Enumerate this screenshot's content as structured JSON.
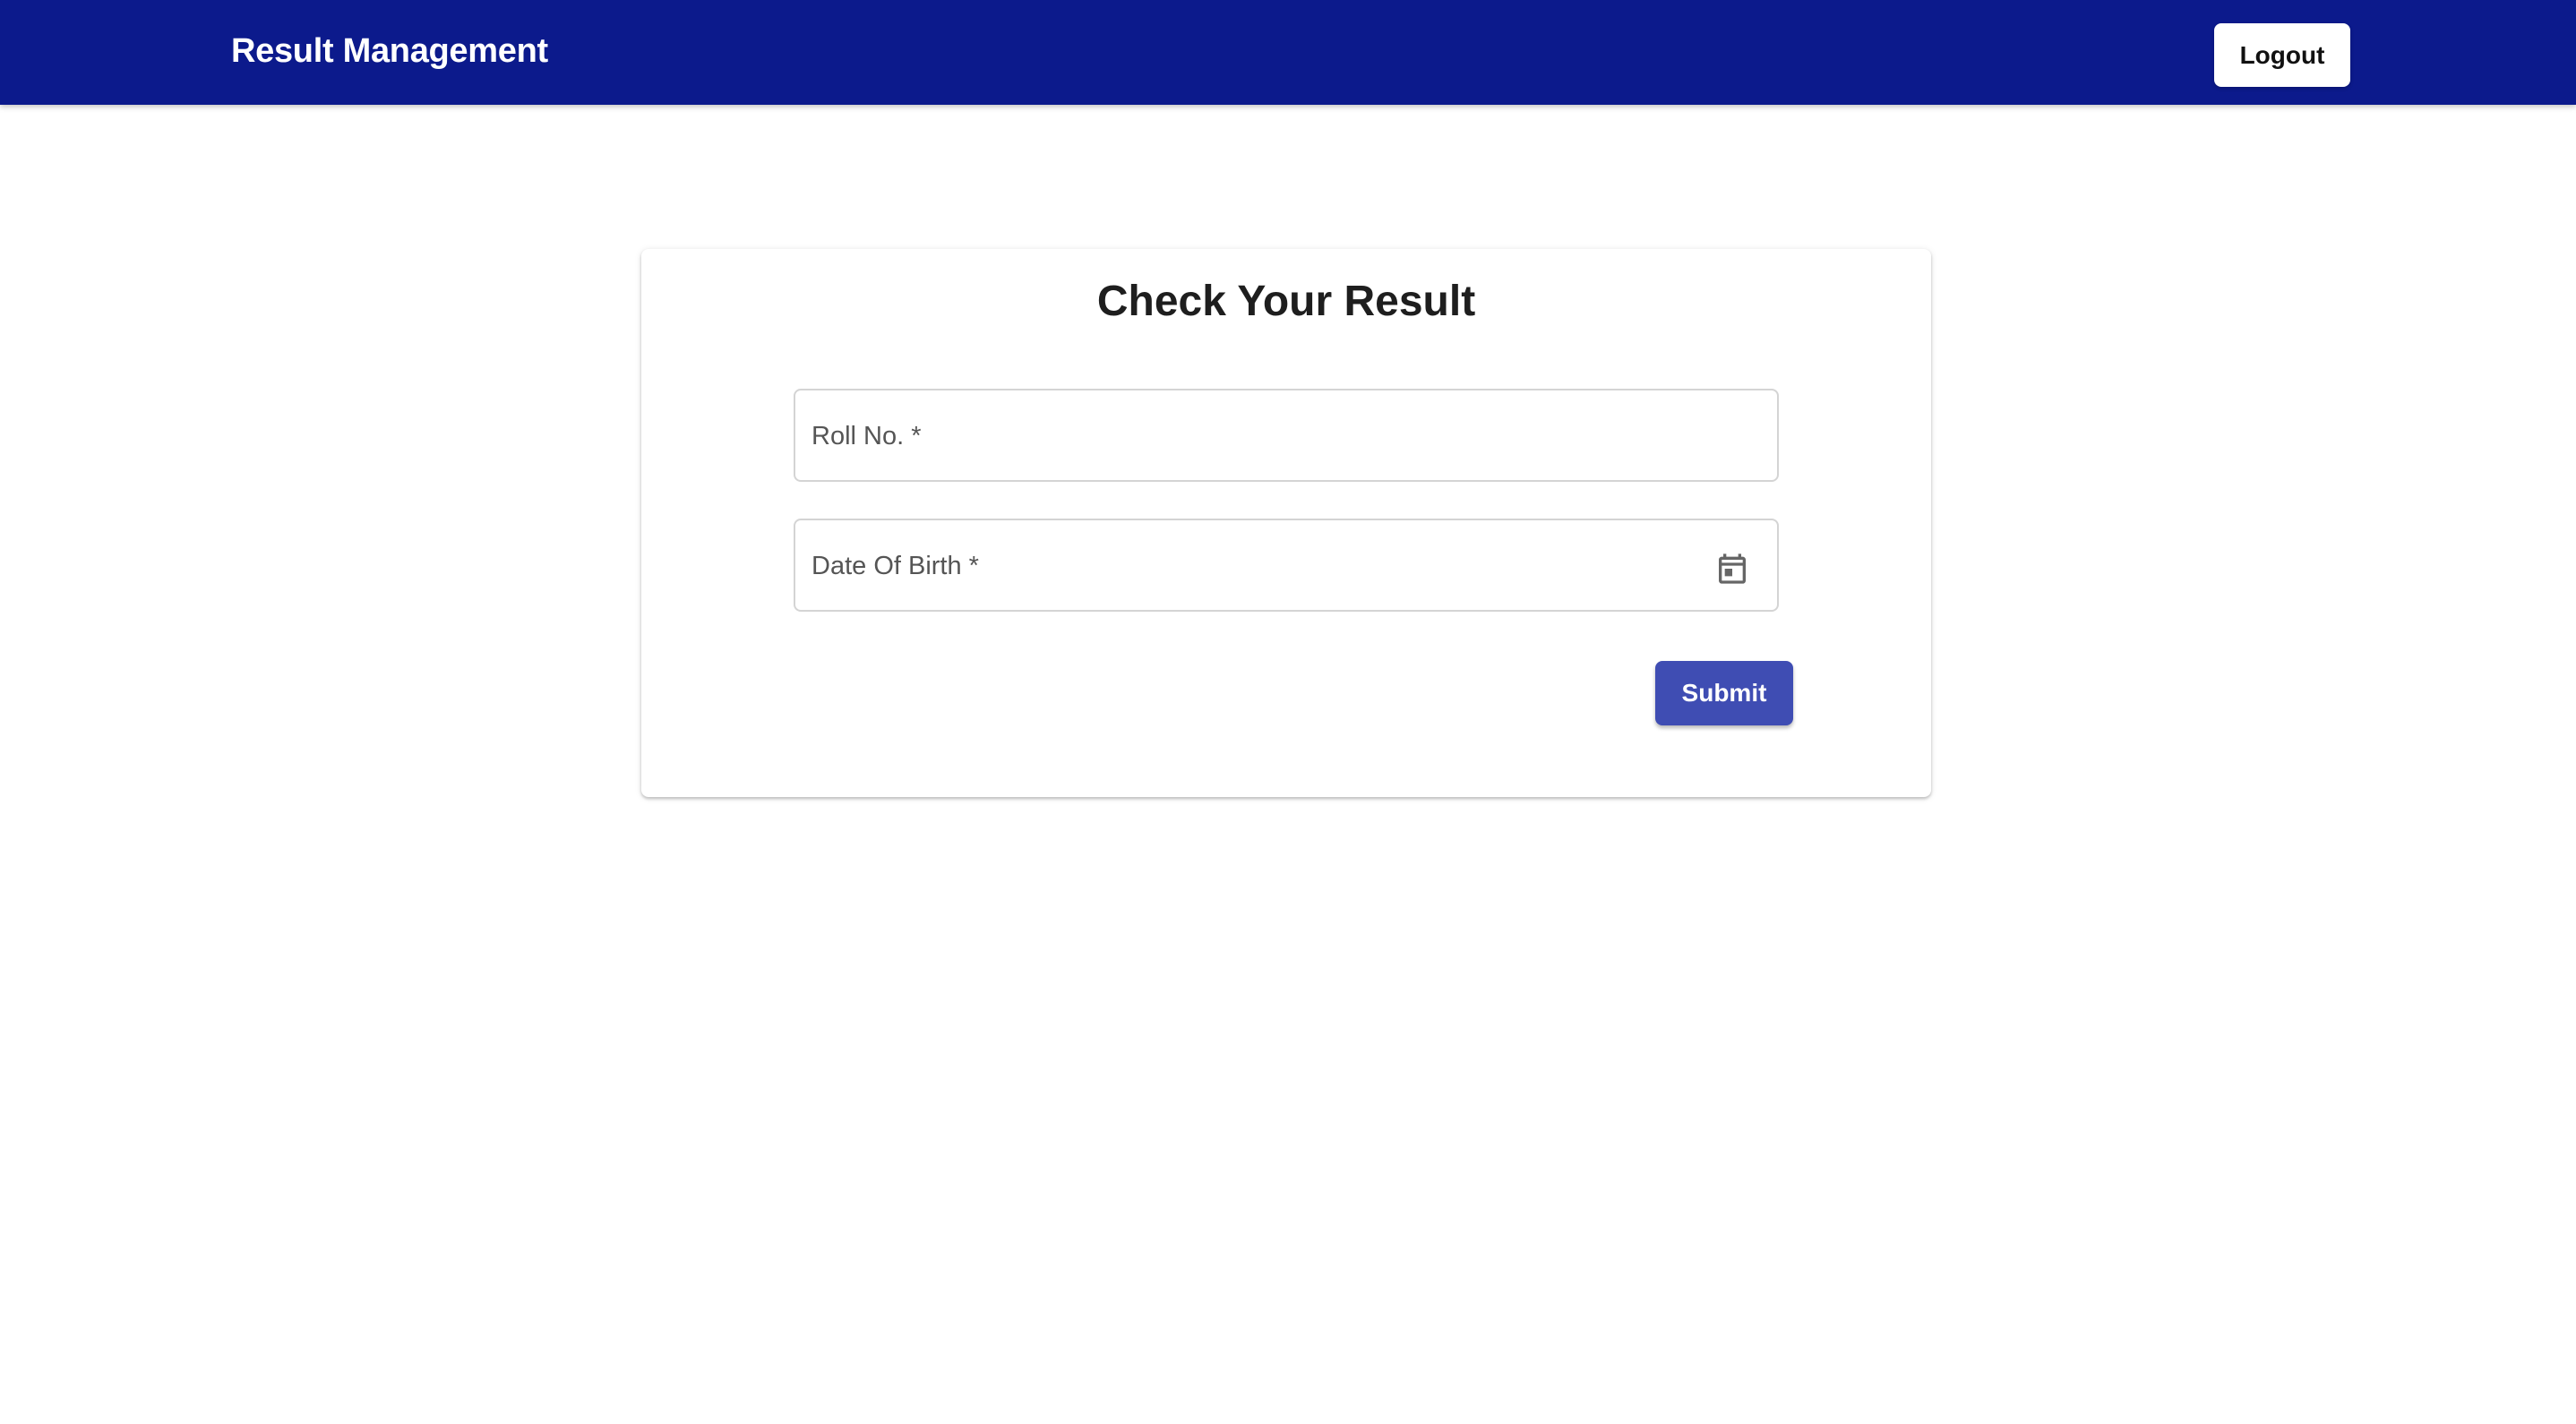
{
  "header": {
    "title": "Result Management",
    "logout_label": "Logout",
    "background_color": "#0c1a8c"
  },
  "form": {
    "title": "Check Your Result",
    "roll_no": {
      "label": "Roll No. *",
      "value": ""
    },
    "date_of_birth": {
      "label": "Date Of Birth *",
      "value": "",
      "icon": "calendar-icon"
    },
    "submit_label": "Submit",
    "submit_color": "#3f4db3"
  }
}
